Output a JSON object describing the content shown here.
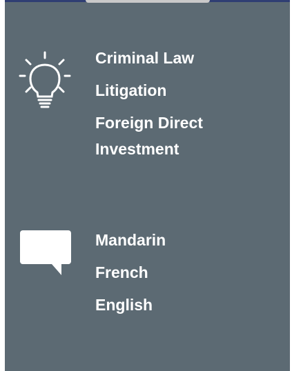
{
  "practice_areas": {
    "icon": "lightbulb-icon",
    "items": [
      "Criminal Law",
      "Litigation",
      "Foreign Direct Investment"
    ]
  },
  "languages": {
    "icon": "speech-bubble-icon",
    "items": [
      "Mandarin",
      "French",
      "English"
    ]
  },
  "colors": {
    "panel_background": "#5c6a73",
    "text": "#ffffff",
    "top_bar": "#2f3e73"
  }
}
